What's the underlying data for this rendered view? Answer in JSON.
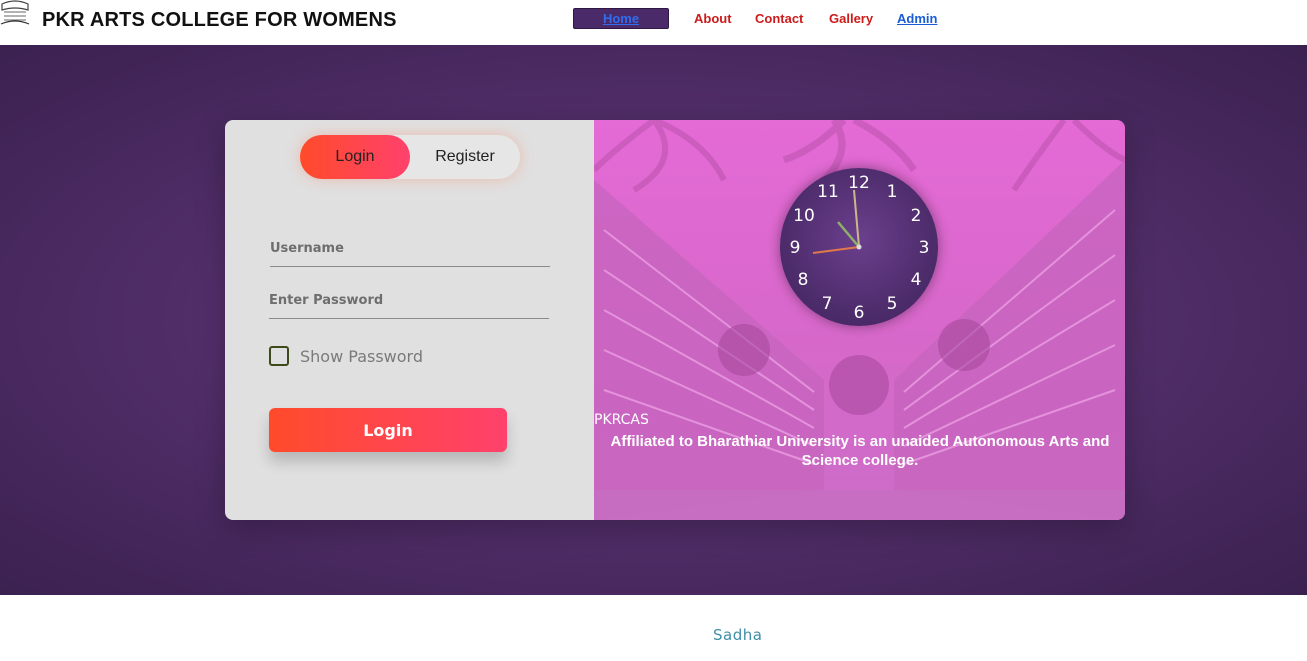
{
  "header": {
    "brand": "PKR ARTS COLLEGE FOR WOMENS",
    "logo_icon": "college-emblem-icon",
    "nav": {
      "home": "Home",
      "about": "About",
      "contact": "Contact",
      "gallery": "Gallery",
      "admin": "Admin"
    }
  },
  "auth": {
    "tabs": {
      "login": "Login",
      "register": "Register"
    },
    "active_tab": "Login",
    "username_placeholder": "Username",
    "username_value": "",
    "password_placeholder": "Enter Password",
    "password_value": "",
    "show_password_label": "Show Password",
    "show_password_checked": false,
    "submit_label": "Login"
  },
  "info": {
    "code": "PKRCAS",
    "description": "Affiliated to Bharathiar University is an unaided Autonomous Arts and Science college.",
    "clock_numbers": [
      "12",
      "1",
      "2",
      "3",
      "4",
      "5",
      "6",
      "7",
      "8",
      "9",
      "10",
      "11"
    ]
  },
  "footer": {
    "text": "Sadha"
  },
  "colors": {
    "accent_gradient_start": "#ff4b2b",
    "accent_gradient_end": "#ff416c",
    "hero_purple": "#4f2c66",
    "nav_red": "#cc1b1b",
    "nav_blue": "#1a5bd6",
    "panel_pink": "#e46ad6"
  }
}
